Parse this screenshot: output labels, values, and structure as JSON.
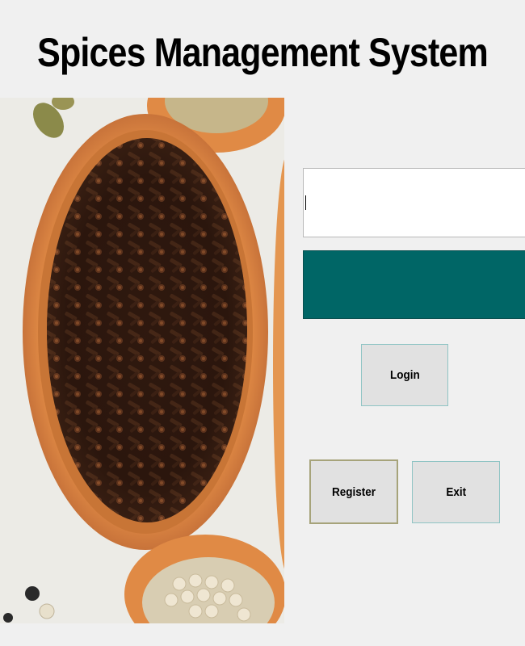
{
  "app": {
    "title": "Spices Management System"
  },
  "hero_image": {
    "description_icon": "spices-photo"
  },
  "login_form": {
    "username_value": "",
    "password_value": "",
    "password_field_color": "#006666",
    "login_label": "Login",
    "register_label": "Register",
    "exit_label": "Exit"
  }
}
